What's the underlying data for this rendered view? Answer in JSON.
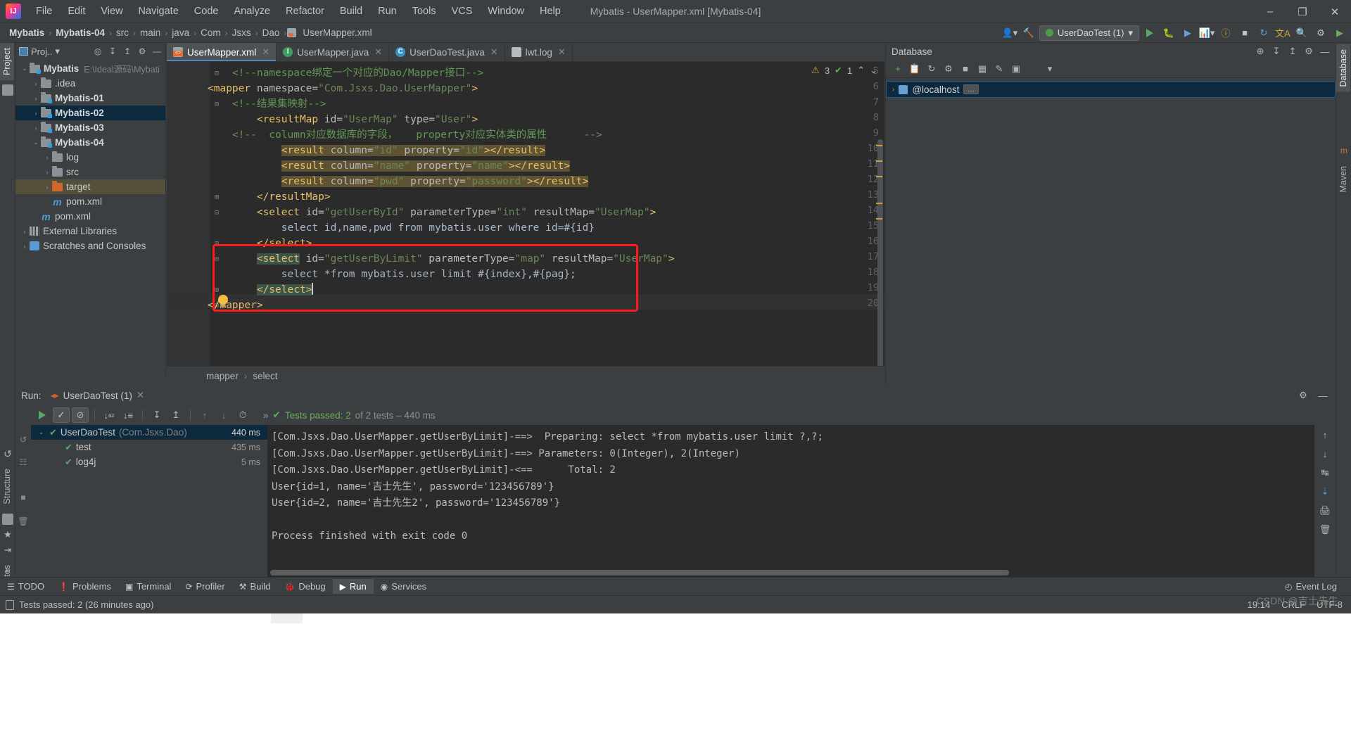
{
  "window": {
    "title": "Mybatis - UserMapper.xml [Mybatis-04]",
    "logo_text": "IJ",
    "minimize": "–",
    "maximize": "❐",
    "close": "✕"
  },
  "menu": {
    "items": [
      "File",
      "Edit",
      "View",
      "Navigate",
      "Code",
      "Analyze",
      "Refactor",
      "Build",
      "Run",
      "Tools",
      "VCS",
      "Window",
      "Help"
    ]
  },
  "breadcrumb": {
    "items": [
      "Mybatis",
      "Mybatis-04",
      "src",
      "main",
      "java",
      "Com",
      "Jsxs",
      "Dao",
      "UserMapper.xml"
    ],
    "separator": "›"
  },
  "nav_right": {
    "run_config": "UserDaoTest (1)",
    "dropdown_caret": "▾",
    "icons": [
      "user-icon",
      "hammer-icon",
      "run-icon",
      "debug-icon",
      "coverage-icon",
      "profile-icon",
      "stop-icon",
      "search-everywhere-icon",
      "updates-icon",
      "translate-icon",
      "search-icon",
      "settings-icon"
    ]
  },
  "left_strip": {
    "tabs": [
      "Project",
      "Structure",
      "Favorites"
    ],
    "bottom_label": "»"
  },
  "right_strip": {
    "tabs": [
      "Database",
      "Maven"
    ]
  },
  "project_panel": {
    "title": "Proj..",
    "caret": "▾",
    "header_icons": [
      "locate-icon",
      "expand-all-icon",
      "collapse-all-icon",
      "settings-icon",
      "hide-icon"
    ],
    "tree": [
      {
        "indent": 0,
        "arrow": "⌄",
        "icon": "module-folder",
        "label": "Mybatis",
        "bold": true,
        "path": "E:\\Ideal源码\\Mybati",
        "state": "normal"
      },
      {
        "indent": 1,
        "arrow": "›",
        "icon": "folder",
        "label": ".idea",
        "bold": false,
        "path": "",
        "state": "normal"
      },
      {
        "indent": 1,
        "arrow": "›",
        "icon": "module-folder",
        "label": "Mybatis-01",
        "bold": true,
        "path": "",
        "state": "normal"
      },
      {
        "indent": 1,
        "arrow": "›",
        "icon": "module-folder",
        "label": "Mybatis-02",
        "bold": true,
        "path": "",
        "state": "selected"
      },
      {
        "indent": 1,
        "arrow": "›",
        "icon": "module-folder",
        "label": "Mybatis-03",
        "bold": true,
        "path": "",
        "state": "normal"
      },
      {
        "indent": 1,
        "arrow": "⌄",
        "icon": "module-folder",
        "label": "Mybatis-04",
        "bold": true,
        "path": "",
        "state": "normal"
      },
      {
        "indent": 2,
        "arrow": "›",
        "icon": "folder",
        "label": "log",
        "bold": false,
        "path": "",
        "state": "normal"
      },
      {
        "indent": 2,
        "arrow": "›",
        "icon": "folder",
        "label": "src",
        "bold": false,
        "path": "",
        "state": "normal"
      },
      {
        "indent": 2,
        "arrow": "›",
        "icon": "folder-orange",
        "label": "target",
        "bold": false,
        "path": "",
        "state": "highlighted"
      },
      {
        "indent": 2,
        "arrow": "",
        "icon": "maven-file",
        "label": "pom.xml",
        "bold": false,
        "path": "",
        "state": "normal"
      },
      {
        "indent": 1,
        "arrow": "",
        "icon": "maven-file",
        "label": "pom.xml",
        "bold": false,
        "path": "",
        "state": "normal"
      },
      {
        "indent": 0,
        "arrow": "›",
        "icon": "library",
        "label": "External Libraries",
        "bold": false,
        "path": "",
        "state": "normal"
      },
      {
        "indent": 0,
        "arrow": "›",
        "icon": "scratch",
        "label": "Scratches and Consoles",
        "bold": false,
        "path": "",
        "state": "normal"
      }
    ]
  },
  "editor": {
    "tabs": [
      {
        "label": "UserMapper.xml",
        "icon": "xml-file-icon",
        "active": true
      },
      {
        "label": "UserMapper.java",
        "icon": "interface-icon",
        "active": false
      },
      {
        "label": "UserDaoTest.java",
        "icon": "class-icon",
        "active": false
      },
      {
        "label": "lwt.log",
        "icon": "log-file-icon",
        "active": false
      }
    ],
    "inspection": {
      "warning_count": "3",
      "ok_count": "1",
      "warning_glyph": "⚠",
      "ok_glyph": "✔",
      "caret_up": "⌃",
      "caret_down": "⌄"
    },
    "first_line_number": 5,
    "lines": [
      {
        "n": 5,
        "segments": [
          {
            "t": "    ",
            "c": "txt"
          },
          {
            "t": "<!--namespace绑定一个对应的Dao/Mapper接口-->",
            "c": "cmt"
          }
        ]
      },
      {
        "n": 6,
        "segments": [
          {
            "t": "<mapper ",
            "c": "tag"
          },
          {
            "t": "namespace=",
            "c": "attr"
          },
          {
            "t": "\"Com.Jsxs.Dao.UserMapper\"",
            "c": "val"
          },
          {
            "t": ">",
            "c": "tag"
          }
        ]
      },
      {
        "n": 7,
        "segments": [
          {
            "t": "    ",
            "c": "txt"
          },
          {
            "t": "<!--结果集映射-->",
            "c": "cmt"
          }
        ]
      },
      {
        "n": 8,
        "segments": [
          {
            "t": "        ",
            "c": "txt"
          },
          {
            "t": "<resultMap ",
            "c": "tag"
          },
          {
            "t": "id=",
            "c": "attr"
          },
          {
            "t": "\"UserMap\"",
            "c": "val"
          },
          {
            "t": " type=",
            "c": "attr"
          },
          {
            "t": "\"User\"",
            "c": "val"
          },
          {
            "t": ">",
            "c": "tag"
          }
        ]
      },
      {
        "n": 9,
        "segments": [
          {
            "t": "    <!--  column对应数据库的字段，   property对应实体类的属性      -->",
            "c": "cmt"
          }
        ]
      },
      {
        "n": 10,
        "segments": [
          {
            "t": "            ",
            "c": "txt"
          },
          {
            "t": "<result ",
            "c": "tag hl"
          },
          {
            "t": "column=",
            "c": "attr hl"
          },
          {
            "t": "\"id\"",
            "c": "val hl"
          },
          {
            "t": " property=",
            "c": "attr hl"
          },
          {
            "t": "\"id\"",
            "c": "val hl"
          },
          {
            "t": "></result>",
            "c": "tag hl"
          }
        ]
      },
      {
        "n": 11,
        "segments": [
          {
            "t": "            ",
            "c": "txt"
          },
          {
            "t": "<result ",
            "c": "tag hl"
          },
          {
            "t": "column=",
            "c": "attr hl"
          },
          {
            "t": "\"name\"",
            "c": "val hl"
          },
          {
            "t": " property=",
            "c": "attr hl"
          },
          {
            "t": "\"name\"",
            "c": "val hl"
          },
          {
            "t": "></result>",
            "c": "tag hl"
          }
        ]
      },
      {
        "n": 12,
        "segments": [
          {
            "t": "            ",
            "c": "txt"
          },
          {
            "t": "<result ",
            "c": "tag hl"
          },
          {
            "t": "column=",
            "c": "attr hl"
          },
          {
            "t": "\"pwd\"",
            "c": "val hl"
          },
          {
            "t": " property=",
            "c": "attr hl"
          },
          {
            "t": "\"password\"",
            "c": "val hl"
          },
          {
            "t": "></result>",
            "c": "tag hl"
          }
        ]
      },
      {
        "n": 13,
        "segments": [
          {
            "t": "        ",
            "c": "txt"
          },
          {
            "t": "</resultMap>",
            "c": "tag"
          }
        ]
      },
      {
        "n": 14,
        "segments": [
          {
            "t": "        ",
            "c": "txt"
          },
          {
            "t": "<select ",
            "c": "tag"
          },
          {
            "t": "id=",
            "c": "attr"
          },
          {
            "t": "\"getUserById\"",
            "c": "val"
          },
          {
            "t": " parameterType=",
            "c": "attr"
          },
          {
            "t": "\"int\"",
            "c": "val"
          },
          {
            "t": " resultMap=",
            "c": "attr"
          },
          {
            "t": "\"UserMap\"",
            "c": "val"
          },
          {
            "t": ">",
            "c": "tag"
          }
        ]
      },
      {
        "n": 15,
        "segments": [
          {
            "t": "            select id,name,pwd from mybatis.user where id=#{id}",
            "c": "txt"
          }
        ]
      },
      {
        "n": 16,
        "segments": [
          {
            "t": "        ",
            "c": "txt"
          },
          {
            "t": "</select>",
            "c": "tag"
          }
        ]
      },
      {
        "n": 17,
        "segments": [
          {
            "t": "        ",
            "c": "txt"
          },
          {
            "t": "<select",
            "c": "tag greenbg"
          },
          {
            "t": " id=",
            "c": "attr"
          },
          {
            "t": "\"getUserByLimit\"",
            "c": "val"
          },
          {
            "t": " parameterType=",
            "c": "attr"
          },
          {
            "t": "\"map\"",
            "c": "val"
          },
          {
            "t": " resultMap=",
            "c": "attr"
          },
          {
            "t": "\"UserMap\"",
            "c": "val"
          },
          {
            "t": ">",
            "c": "tag"
          }
        ]
      },
      {
        "n": 18,
        "segments": [
          {
            "t": "            select *from mybatis.user limit #{index},#{pag};",
            "c": "txt"
          }
        ]
      },
      {
        "n": 19,
        "segments": [
          {
            "t": "        ",
            "c": "txt"
          },
          {
            "t": "</select>",
            "c": "tag greenbg"
          }
        ]
      },
      {
        "n": 20,
        "segments": [
          {
            "t": "</mapper>",
            "c": "tag"
          }
        ]
      }
    ],
    "breadcrumb": {
      "items": [
        "mapper",
        "select"
      ],
      "separator": "›"
    }
  },
  "database_panel": {
    "title": "Database",
    "header_icons": [
      "add-icon",
      "refresh-icon",
      "settings-icon",
      "hide-icon"
    ],
    "toolbar_icons": [
      "plus-icon",
      "copy-icon",
      "sync-icon",
      "run-sql-icon",
      "stop-icon",
      "table-icon",
      "edit-icon",
      "view-icon",
      "filter-icon"
    ],
    "items": [
      {
        "arrow": "›",
        "label": "@localhost",
        "more": "..."
      }
    ]
  },
  "run_panel": {
    "label": "Run:",
    "tab": "UserDaoTest (1)",
    "close_glyph": "✕",
    "toolbar_icons": [
      "rerun-icon",
      "show-passed-icon",
      "hide-ignored-icon",
      "sort-alpha-icon",
      "sort-duration-icon",
      "expand-all-icon",
      "collapse-all-icon",
      "prev-icon",
      "next-icon",
      "history-icon"
    ],
    "status": {
      "chevrons": "»",
      "check": "✔",
      "passed_label": "Tests passed: 2",
      "of_label": "of 2 tests – 440 ms"
    },
    "tests": [
      {
        "indent": 0,
        "arrow": "⌄",
        "label": "UserDaoTest",
        "pkg": "(Com.Jsxs.Dao)",
        "ms": "440 ms",
        "selected": true
      },
      {
        "indent": 1,
        "arrow": "",
        "label": "test",
        "pkg": "",
        "ms": "435 ms",
        "selected": false
      },
      {
        "indent": 1,
        "arrow": "",
        "label": "log4j",
        "pkg": "",
        "ms": "5 ms",
        "selected": false
      }
    ],
    "console": [
      "[Com.Jsxs.Dao.UserMapper.getUserByLimit]-==>  Preparing: select *from mybatis.user limit ?,?;",
      "[Com.Jsxs.Dao.UserMapper.getUserByLimit]-==> Parameters: 0(Integer), 2(Integer)",
      "[Com.Jsxs.Dao.UserMapper.getUserByLimit]-<==      Total: 2",
      "User{id=1, name='吉士先生', password='123456789'}",
      "User{id=2, name='吉士先生2', password='123456789'}",
      "",
      "Process finished with exit code 0"
    ],
    "console_side_icons": [
      "scroll-up-icon",
      "scroll-down-icon",
      "soft-wrap-icon",
      "scroll-to-end-icon",
      "print-icon",
      "clear-icon"
    ]
  },
  "bottom_bar": {
    "items": [
      {
        "label": "TODO",
        "icon": "todo-icon",
        "active": false
      },
      {
        "label": "Problems",
        "icon": "problems-icon",
        "active": false
      },
      {
        "label": "Terminal",
        "icon": "terminal-icon",
        "active": false
      },
      {
        "label": "Profiler",
        "icon": "profiler-icon",
        "active": false
      },
      {
        "label": "Build",
        "icon": "build-icon",
        "active": false
      },
      {
        "label": "Debug",
        "icon": "debug-icon",
        "active": false
      },
      {
        "label": "Run",
        "icon": "run-icon",
        "active": true
      },
      {
        "label": "Services",
        "icon": "services-icon",
        "active": false
      }
    ],
    "event_log": "Event Log"
  },
  "status_bar": {
    "message": "Tests passed: 2 (26 minutes ago)",
    "time": "19:14",
    "line_sep": "CRLF",
    "encoding": "UTF-8",
    "watermark": "CSDN @吉士先生"
  }
}
